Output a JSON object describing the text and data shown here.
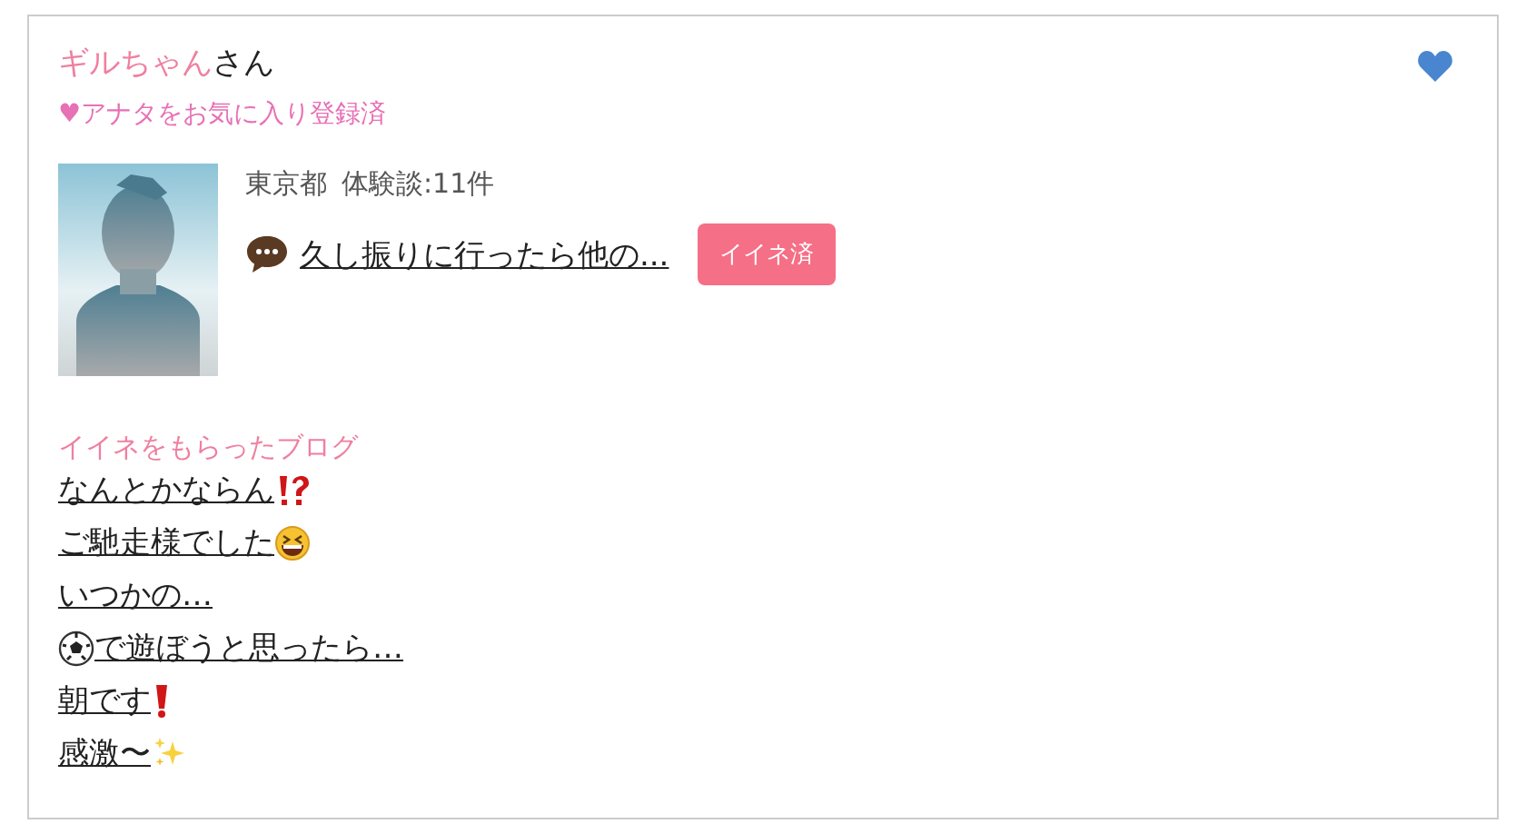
{
  "user": {
    "name": "ギルちゃん",
    "suffix": "さん",
    "favorite_note": "♥アナタをお気に入り登録済",
    "favorited": true
  },
  "profile": {
    "location": "東京都",
    "experience": "体験談:11件",
    "latest_post": "久し振りに行ったら他の...",
    "like_button": {
      "label": "イイネ済",
      "liked": true
    }
  },
  "liked_blogs": {
    "heading": "イイネをもらったブログ",
    "items": [
      {
        "text": "なんとかならん",
        "kind": "interrobang"
      },
      {
        "text": "ご馳走様でした",
        "kind": "laughing"
      },
      {
        "text": "いつかの…",
        "kind": "plain"
      },
      {
        "text": "で遊ぼうと思ったら…",
        "kind": "soccer"
      },
      {
        "text": "朝です",
        "kind": "exclamation"
      },
      {
        "text": "感激〜",
        "kind": "sparkles"
      }
    ]
  }
}
